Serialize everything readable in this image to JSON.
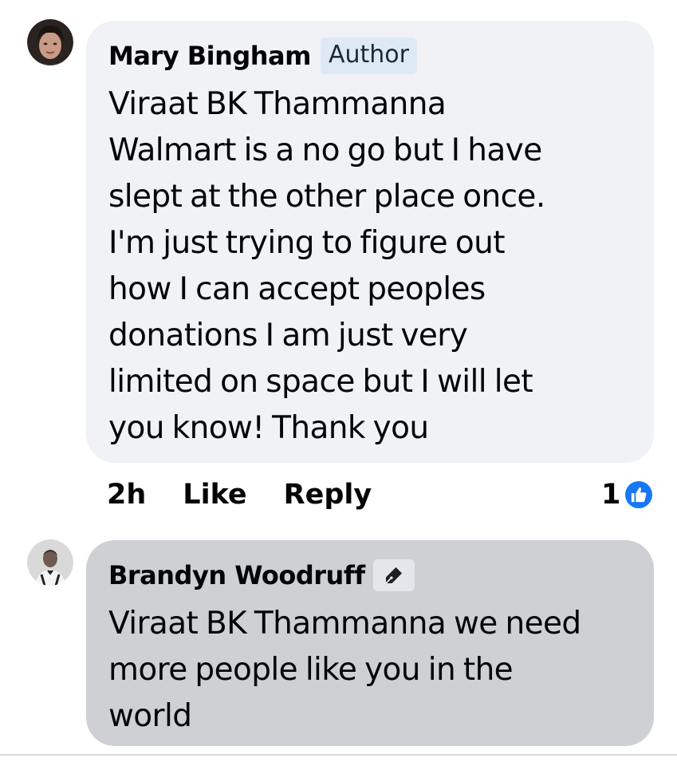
{
  "comment1": {
    "author": "Mary Bingham",
    "badge": "Author",
    "lines": [
      "Viraat BK Thammanna",
      "Walmart is a no go but I have",
      "slept at the other place once.",
      "I'm just trying to figure out",
      "how I can accept peoples",
      "donations I am just very",
      "limited on space but I will let",
      "you know! Thank you"
    ],
    "time": "2h",
    "like_label": "Like",
    "reply_label": "Reply",
    "reaction_count": "1",
    "reaction_icon": "thumbs-up-icon"
  },
  "comment2": {
    "author": "Brandyn Woodruff",
    "badge_icon": "pen-icon",
    "lines": [
      "Viraat BK Thammanna we need",
      "more people like you in the",
      "world"
    ]
  },
  "colors": {
    "bubble_primary": "#f0f2f5",
    "bubble_secondary": "#ced0d4",
    "author_badge_bg": "#dfe9f6",
    "like_blue": "#1877f2"
  }
}
